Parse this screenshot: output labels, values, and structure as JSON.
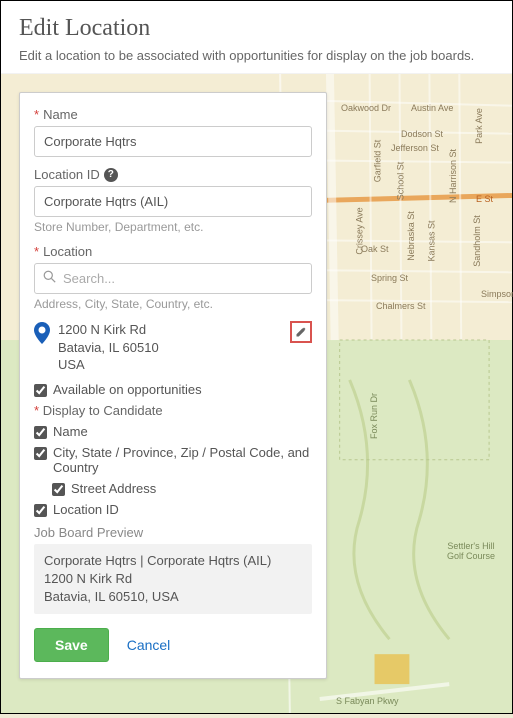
{
  "header": {
    "title": "Edit Location",
    "subtitle": "Edit a location to be associated with opportunities for display on the job boards."
  },
  "form": {
    "name_label": "Name",
    "name_value": "Corporate Hqtrs",
    "location_id_label": "Location ID",
    "location_id_value": "Corporate Hqtrs (AIL)",
    "location_id_helper": "Store Number, Department, etc.",
    "location_label": "Location",
    "location_placeholder": "Search...",
    "location_helper": "Address, City, State, Country, etc.",
    "address": {
      "line1": "1200 N Kirk Rd",
      "line2": "Batavia, IL 60510",
      "line3": "USA"
    },
    "available_label": "Available on opportunities",
    "display_section": "Display to Candidate",
    "display_name": "Name",
    "display_city": "City, State / Province, Zip / Postal Code, and Country",
    "display_street": "Street Address",
    "display_locid": "Location ID",
    "preview_label": "Job Board Preview",
    "preview": {
      "line1": "Corporate Hqtrs | Corporate Hqtrs (AIL)",
      "line2": "1200 N Kirk Rd",
      "line3": "Batavia, IL 60510, USA"
    },
    "save": "Save",
    "cancel": "Cancel"
  },
  "map_labels": {
    "oakwood": "Oakwood Dr",
    "austin": "Austin Ave",
    "dodson": "Dodson St",
    "jefferson": "Jefferson St",
    "park": "Park Ave",
    "garfield": "Garfield St",
    "school": "School St",
    "harrison": "N Harrison St",
    "crissey": "Crissey Ave",
    "nebraska": "Nebraska St",
    "kansas": "Kansas St",
    "sandholm": "Sandholm St",
    "oak": "Oak St",
    "spring": "Spring St",
    "chalmers": "Chalmers St",
    "foxrun": "Fox Run Dr",
    "settlers": "Settler's Hill Golf Course",
    "fabyan": "S Fabyan Pkwy",
    "simpson": "Simpson",
    "e_st": "E St"
  }
}
